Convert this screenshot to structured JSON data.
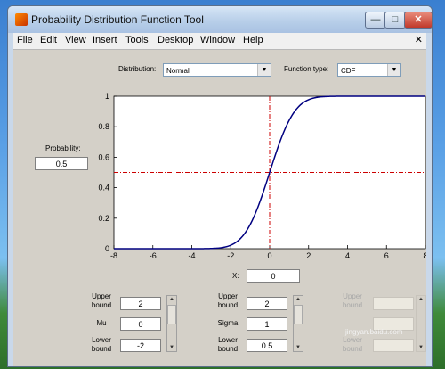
{
  "window": {
    "title": "Probability Distribution Function Tool",
    "buttons": {
      "minimize": "—",
      "maximize": "□",
      "close": "✕"
    }
  },
  "menu": {
    "items": [
      "File",
      "Edit",
      "View",
      "Insert",
      "Tools",
      "Desktop",
      "Window",
      "Help"
    ],
    "close_glyph": "✕"
  },
  "controls": {
    "distribution_label": "Distribution:",
    "distribution_value": "Normal",
    "function_type_label": "Function type:",
    "function_type_value": "CDF"
  },
  "probability": {
    "label": "Probability:",
    "value": "0.5"
  },
  "x_input": {
    "label": "X:",
    "value": "0"
  },
  "params": [
    {
      "upper_label": "Upper\nbound",
      "upper": "2",
      "name": "Mu",
      "value": "0",
      "lower_label": "Lower\nbound",
      "lower": "-2",
      "enabled": true
    },
    {
      "upper_label": "Upper\nbound",
      "upper": "2",
      "name": "Sigma",
      "value": "1",
      "lower_label": "Lower\nbound",
      "lower": "0.5",
      "enabled": true
    },
    {
      "upper_label": "Upper\nbound",
      "upper": "",
      "name": "",
      "value": "",
      "lower_label": "Lower\nbound",
      "lower": "",
      "enabled": false
    }
  ],
  "watermark": "jingyan.baidu.com",
  "chart_data": {
    "type": "line",
    "title": "",
    "xlabel": "",
    "ylabel": "",
    "xlim": [
      -8,
      8
    ],
    "ylim": [
      0,
      1
    ],
    "xticks": [
      -8,
      -6,
      -4,
      -2,
      0,
      2,
      4,
      6,
      8
    ],
    "yticks": [
      0,
      0.2,
      0.4,
      0.6,
      0.8,
      1
    ],
    "grid": false,
    "series": [
      {
        "color": "#000080",
        "function": "normal_cdf",
        "mu": 0,
        "sigma": 1
      }
    ],
    "crosshair": {
      "x": 0,
      "y": 0.5,
      "color": "#cc0000",
      "style": "dash-dot"
    }
  }
}
